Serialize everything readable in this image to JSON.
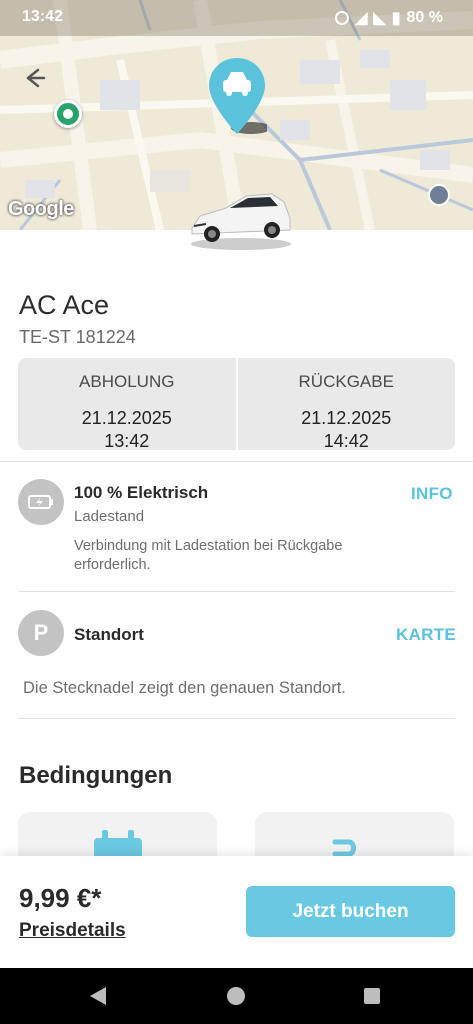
{
  "status_bar": {
    "time": "13:42",
    "battery": "80 %"
  },
  "map": {
    "attribution": "Google",
    "back_icon": "arrow-left-icon",
    "pin_icon": "car-icon"
  },
  "vehicle": {
    "name": "AC Ace",
    "plate": "TE-ST 181224"
  },
  "booking": {
    "pickup": {
      "label": "ABHOLUNG",
      "date": "21.12.2025",
      "time": "13:42"
    },
    "return": {
      "label": "RÜCKGABE",
      "date": "21.12.2025",
      "time": "14:42"
    }
  },
  "charge": {
    "title": "100 % Elektrisch",
    "subtitle": "Ladestand",
    "note": "Verbindung mit Ladestation bei Rückgabe erforderlich.",
    "action": "INFO",
    "icon": "battery-icon"
  },
  "location": {
    "title": "Standort",
    "action": "KARTE",
    "note": "Die Stecknadel zeigt den genauen Standort.",
    "icon_letter": "P"
  },
  "conditions": {
    "title": "Bedingungen"
  },
  "footer": {
    "price": "9,99 €*",
    "price_details": "Preisdetails",
    "book_label": "Jetzt buchen"
  },
  "colors": {
    "accent": "#5bc2dc",
    "button": "#6ac9e2",
    "map_bg": "#f1ecdc"
  }
}
